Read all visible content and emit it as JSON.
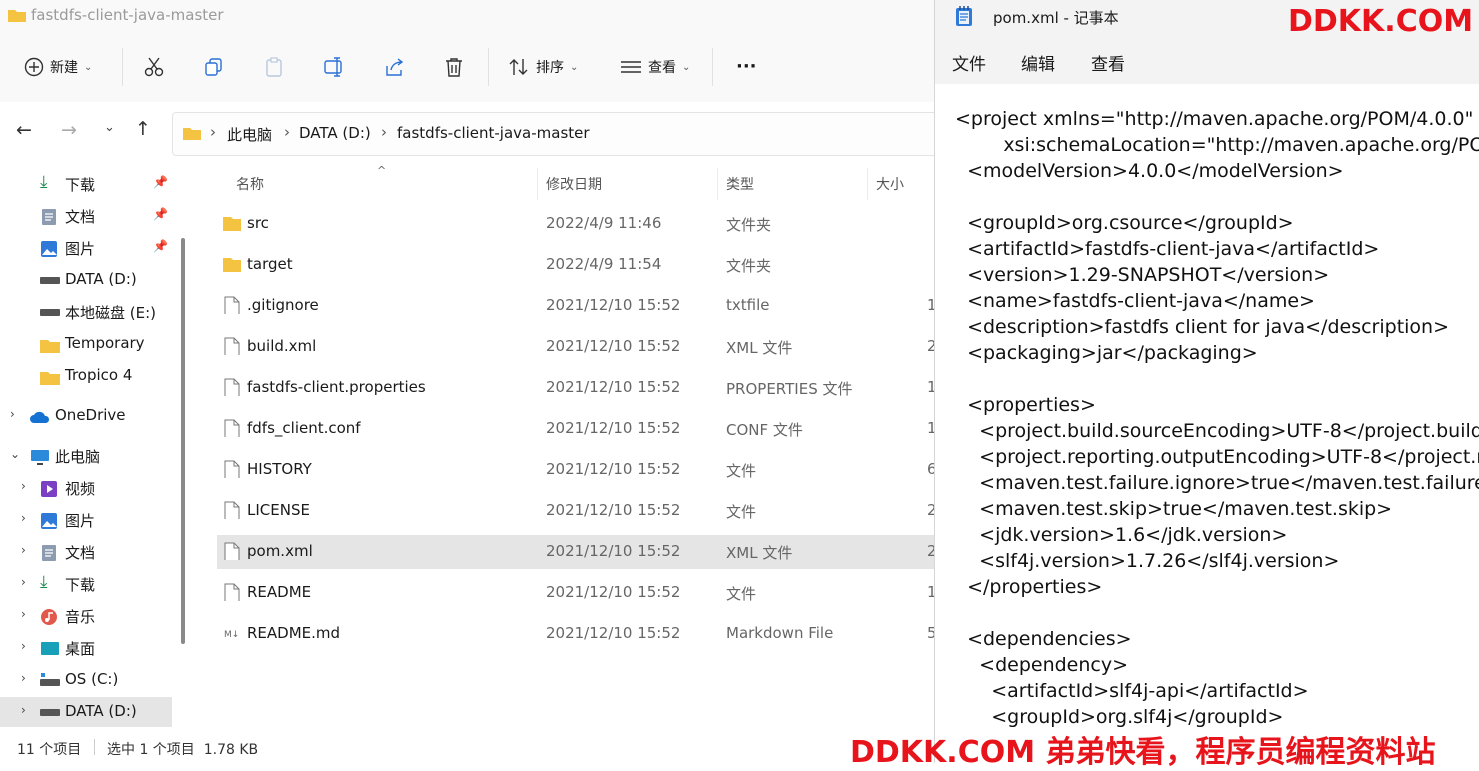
{
  "explorer": {
    "title": "fastdfs-client-java-master",
    "toolbar": {
      "new_label": "新建",
      "sort_label": "排序",
      "view_label": "查看",
      "more_label": "···"
    },
    "breadcrumb": [
      "此电脑",
      "DATA (D:)",
      "fastdfs-client-java-master"
    ],
    "sidebar": {
      "quick": [
        {
          "label": "下载",
          "icon": "download-icon"
        },
        {
          "label": "文档",
          "icon": "document-icon"
        },
        {
          "label": "图片",
          "icon": "picture-icon"
        },
        {
          "label": "DATA (D:)",
          "icon": "drive-icon"
        },
        {
          "label": "本地磁盘 (E:)",
          "icon": "drive-icon"
        },
        {
          "label": "Temporary",
          "icon": "folder-icon"
        },
        {
          "label": "Tropico 4",
          "icon": "folder-icon"
        }
      ],
      "onedrive": "OneDrive",
      "thispc": "此电脑",
      "pc_items": [
        "视频",
        "图片",
        "文档",
        "下载",
        "音乐",
        "桌面",
        "OS (C:)",
        "DATA (D:)"
      ]
    },
    "columns": {
      "name": "名称",
      "date": "修改日期",
      "type": "类型",
      "size": "大小"
    },
    "files": [
      {
        "name": "src",
        "date": "2022/4/9 11:46",
        "type": "文件夹",
        "size": "",
        "kind": "folder"
      },
      {
        "name": "target",
        "date": "2022/4/9 11:54",
        "type": "文件夹",
        "size": "",
        "kind": "folder"
      },
      {
        "name": ".gitignore",
        "date": "2021/12/10 15:52",
        "type": "txtfile",
        "size": "1",
        "kind": "file"
      },
      {
        "name": "build.xml",
        "date": "2021/12/10 15:52",
        "type": "XML 文件",
        "size": "2",
        "kind": "file"
      },
      {
        "name": "fastdfs-client.properties",
        "date": "2021/12/10 15:52",
        "type": "PROPERTIES 文件",
        "size": "1",
        "kind": "file"
      },
      {
        "name": "fdfs_client.conf",
        "date": "2021/12/10 15:52",
        "type": "CONF 文件",
        "size": "1",
        "kind": "file"
      },
      {
        "name": "HISTORY",
        "date": "2021/12/10 15:52",
        "type": "文件",
        "size": "6",
        "kind": "file"
      },
      {
        "name": "LICENSE",
        "date": "2021/12/10 15:52",
        "type": "文件",
        "size": "2",
        "kind": "file"
      },
      {
        "name": "pom.xml",
        "date": "2021/12/10 15:52",
        "type": "XML 文件",
        "size": "2",
        "kind": "file"
      },
      {
        "name": "README",
        "date": "2021/12/10 15:52",
        "type": "文件",
        "size": "1",
        "kind": "file"
      },
      {
        "name": "README.md",
        "date": "2021/12/10 15:52",
        "type": "Markdown File",
        "size": "5",
        "kind": "md"
      }
    ],
    "status": {
      "count": "11 个项目",
      "selection": "选中 1 个项目  1.78 KB"
    }
  },
  "notepad": {
    "title": "pom.xml - 记事本",
    "menu": [
      "文件",
      "编辑",
      "查看"
    ],
    "content": "<project xmlns=\"http://maven.apache.org/POM/4.0.0\"\n        xsi:schemaLocation=\"http://maven.apache.org/POM/4.0.0\n  <modelVersion>4.0.0</modelVersion>\n\n  <groupId>org.csource</groupId>\n  <artifactId>fastdfs-client-java</artifactId>\n  <version>1.29-SNAPSHOT</version>\n  <name>fastdfs-client-java</name>\n  <description>fastdfs client for java</description>\n  <packaging>jar</packaging>\n\n  <properties>\n    <project.build.sourceEncoding>UTF-8</project.build.sourceEncoding>\n    <project.reporting.outputEncoding>UTF-8</project.reporting.outputEncoding>\n    <maven.test.failure.ignore>true</maven.test.failure.ignore>\n    <maven.test.skip>true</maven.test.skip>\n    <jdk.version>1.6</jdk.version>\n    <slf4j.version>1.7.26</slf4j.version>\n  </properties>\n\n  <dependencies>\n    <dependency>\n      <artifactId>slf4j-api</artifactId>\n      <groupId>org.slf4j</groupId>"
  },
  "watermark": {
    "top": "DDKK.COM",
    "bottom": "DDKK.COM 弟弟快看，程序员编程资料站"
  },
  "colors": {
    "watermark": "#e8141c",
    "folder": "#f5c342",
    "selection": "#e5e5e5"
  }
}
